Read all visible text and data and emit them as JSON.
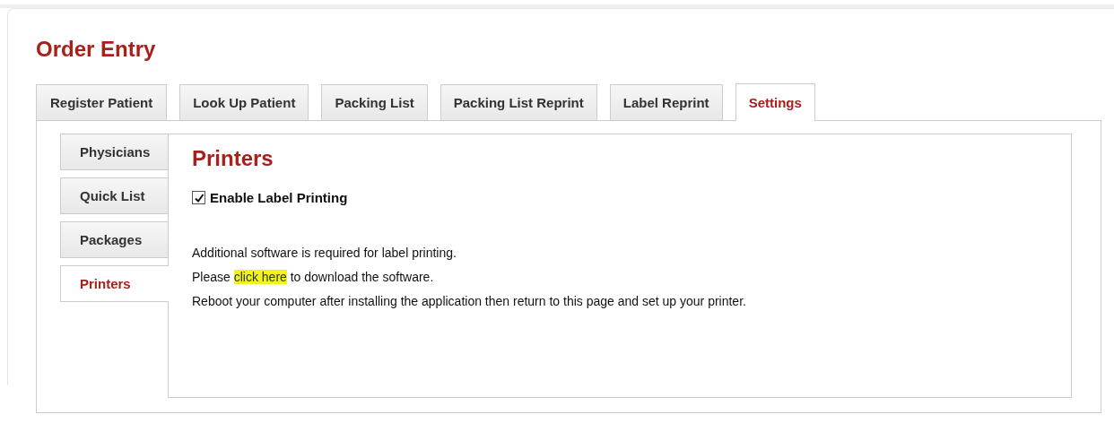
{
  "page_title": "Order Entry",
  "tabs": [
    {
      "label": "Register Patient",
      "selected": false
    },
    {
      "label": "Look Up Patient",
      "selected": false
    },
    {
      "label": "Packing List",
      "selected": false
    },
    {
      "label": "Packing List Reprint",
      "selected": false
    },
    {
      "label": "Label Reprint",
      "selected": false
    },
    {
      "label": "Settings",
      "selected": true
    }
  ],
  "side_tabs": [
    {
      "label": "Physicians",
      "selected": false
    },
    {
      "label": "Quick List",
      "selected": false
    },
    {
      "label": "Packages",
      "selected": false
    },
    {
      "label": "Printers",
      "selected": true
    }
  ],
  "panel": {
    "heading": "Printers",
    "enable_label_printing": {
      "label": "Enable Label Printing",
      "checked": true
    },
    "info_line": "Additional software is required for label printing.",
    "download_line": {
      "before": "Please ",
      "link": "click here",
      "after": " to download the software."
    },
    "reboot_line": "Reboot your computer after installing the application then return to this page and set up your printer."
  }
}
